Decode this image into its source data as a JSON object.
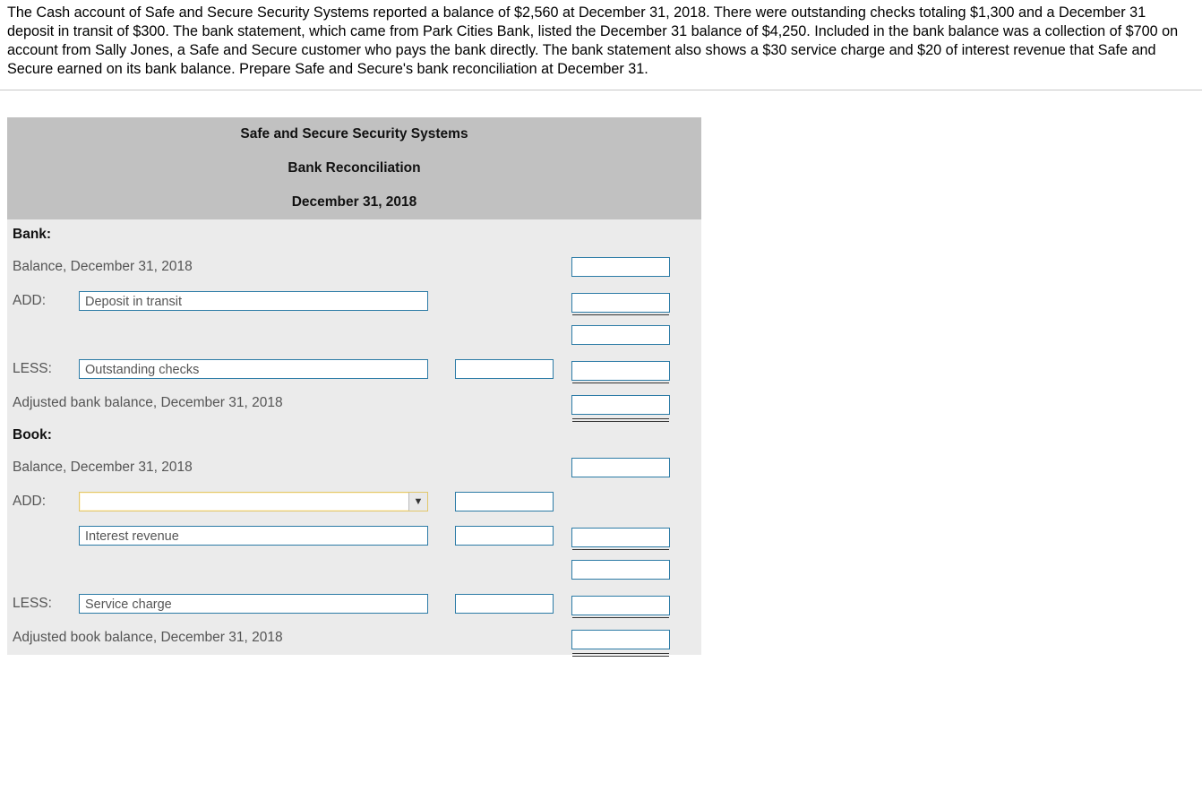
{
  "problem_text": "The Cash account of Safe and Secure Security Systems reported a balance of $2,560 at December 31, 2018. There were outstanding checks totaling $1,300 and a December 31 deposit in transit of $300. The bank statement, which came from Park Cities Bank, listed the December 31 balance of $4,250. Included in the bank balance was a collection of $700 on account from Sally Jones, a Safe and Secure customer who pays the bank directly. The bank statement also shows a $30 service charge and $20 of interest revenue that Safe and Secure earned on its bank balance. Prepare Safe and Secure's bank reconciliation at December 31.",
  "header": {
    "company": "Safe and Secure Security Systems",
    "title": "Bank Reconciliation",
    "date": "December 31, 2018"
  },
  "bank": {
    "section": "Bank:",
    "balance_label": "Balance, December 31, 2018",
    "add_label": "ADD:",
    "add_item": "Deposit in transit",
    "less_label": "LESS:",
    "less_item": "Outstanding checks",
    "adjusted_label": "Adjusted bank balance, December 31, 2018"
  },
  "book": {
    "section": "Book:",
    "balance_label": "Balance, December 31, 2018",
    "add_label": "ADD:",
    "add_item_1": "",
    "add_item_2": "Interest revenue",
    "less_label": "LESS:",
    "less_item": "Service charge",
    "adjusted_label": "Adjusted book balance, December 31, 2018"
  }
}
